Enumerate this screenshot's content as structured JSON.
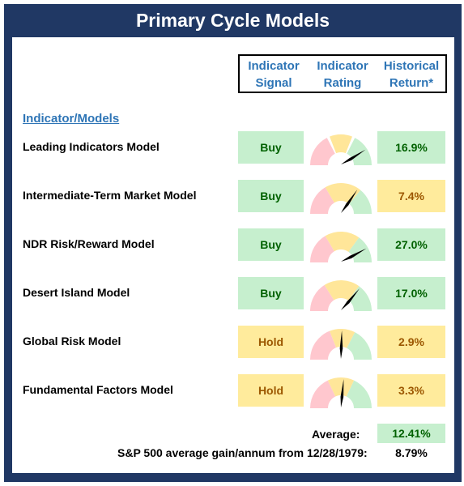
{
  "title": "Primary Cycle Models",
  "headers": [
    {
      "line1": "Indicator",
      "line2": "Signal"
    },
    {
      "line1": "Indicator",
      "line2": "Rating"
    },
    {
      "line1": "Historical",
      "line2": "Return*"
    }
  ],
  "section_label": "Indicator/Models",
  "colors": {
    "frame": "#203864",
    "header_text": "#2e75b6",
    "buy_bg": "#c6efce",
    "buy_text": "#006100",
    "hold_bg": "#ffeb9c",
    "hold_text": "#9c5700",
    "gauge_red": "#ffc7ce",
    "gauge_yellow": "#ffe699",
    "gauge_green": "#c6efce"
  },
  "models": [
    {
      "name": "Leading Indicators Model",
      "signal": "Buy",
      "signal_type": "buy",
      "rating": 0.82,
      "bands": [
        0.35,
        0.38,
        0.62,
        0.65
      ],
      "return": "16.9%",
      "return_type": "buy"
    },
    {
      "name": "Intermediate-Term Market Model",
      "signal": "Buy",
      "signal_type": "buy",
      "rating": 0.69,
      "bands": [
        0.33,
        0.33,
        0.72,
        0.72
      ],
      "return": "7.4%",
      "return_type": "hold"
    },
    {
      "name": "NDR Risk/Reward Model",
      "signal": "Buy",
      "signal_type": "buy",
      "rating": 0.84,
      "bands": [
        0.33,
        0.33,
        0.7,
        0.7
      ],
      "return": "27.0%",
      "return_type": "buy"
    },
    {
      "name": "Desert Island Model",
      "signal": "Buy",
      "signal_type": "buy",
      "rating": 0.72,
      "bands": [
        0.32,
        0.32,
        0.7,
        0.7
      ],
      "return": "17.0%",
      "return_type": "buy"
    },
    {
      "name": "Global Risk Model",
      "signal": "Hold",
      "signal_type": "hold",
      "rating": 0.51,
      "bands": [
        0.38,
        0.38,
        0.65,
        0.65
      ],
      "return": "2.9%",
      "return_type": "hold"
    },
    {
      "name": "Fundamental Factors Model",
      "signal": "Hold",
      "signal_type": "hold",
      "rating": 0.53,
      "bands": [
        0.36,
        0.36,
        0.64,
        0.64
      ],
      "return": "3.3%",
      "return_type": "hold"
    }
  ],
  "average": {
    "label": "Average:",
    "value": "12.41%"
  },
  "sp500": {
    "label": "S&P 500 average gain/annum from 12/28/1979:",
    "value": "8.79%"
  }
}
